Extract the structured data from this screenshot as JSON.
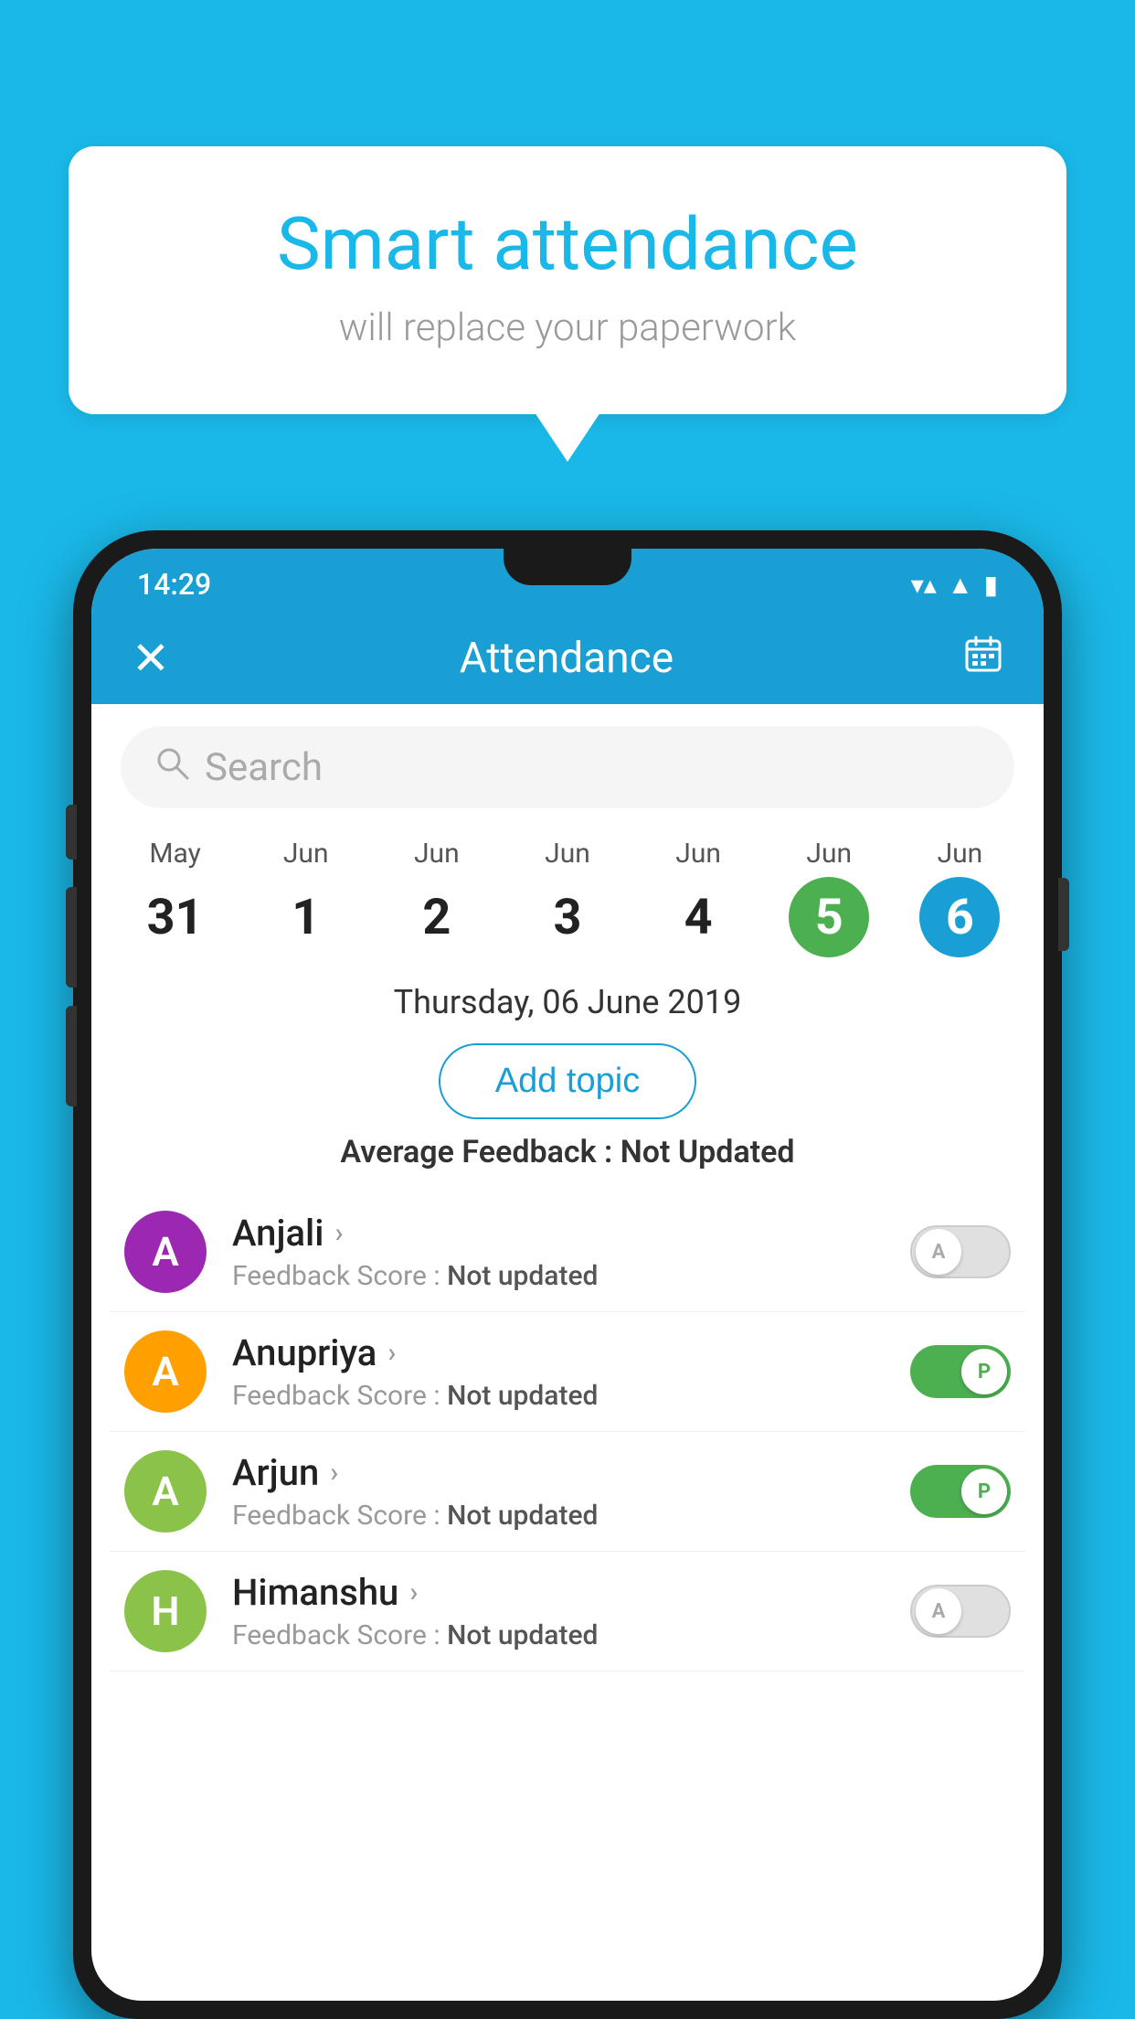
{
  "background_color": "#1ab8e8",
  "speech_bubble": {
    "title": "Smart attendance",
    "subtitle": "will replace your paperwork"
  },
  "status_bar": {
    "time": "14:29",
    "wifi": "▼",
    "signal": "▲",
    "battery": "▮"
  },
  "app_header": {
    "close_label": "✕",
    "title": "Attendance",
    "calendar_icon": "📅"
  },
  "search": {
    "placeholder": "Search"
  },
  "date_strip": {
    "dates": [
      {
        "month": "May",
        "day": "31",
        "state": "normal"
      },
      {
        "month": "Jun",
        "day": "1",
        "state": "normal"
      },
      {
        "month": "Jun",
        "day": "2",
        "state": "normal"
      },
      {
        "month": "Jun",
        "day": "3",
        "state": "normal"
      },
      {
        "month": "Jun",
        "day": "4",
        "state": "normal"
      },
      {
        "month": "Jun",
        "day": "5",
        "state": "today"
      },
      {
        "month": "Jun",
        "day": "6",
        "state": "selected"
      }
    ]
  },
  "selected_date_label": "Thursday, 06 June 2019",
  "add_topic_label": "Add topic",
  "avg_feedback_label": "Average Feedback :",
  "avg_feedback_value": "Not Updated",
  "students": [
    {
      "name": "Anjali",
      "avatar_letter": "A",
      "avatar_color": "#9c27b0",
      "feedback_label": "Feedback Score :",
      "feedback_value": "Not updated",
      "toggle": "off",
      "toggle_letter": "A"
    },
    {
      "name": "Anupriya",
      "avatar_letter": "A",
      "avatar_color": "#ffa000",
      "feedback_label": "Feedback Score :",
      "feedback_value": "Not updated",
      "toggle": "on",
      "toggle_letter": "P"
    },
    {
      "name": "Arjun",
      "avatar_letter": "A",
      "avatar_color": "#8bc34a",
      "feedback_label": "Feedback Score :",
      "feedback_value": "Not updated",
      "toggle": "on",
      "toggle_letter": "P"
    },
    {
      "name": "Himanshu",
      "avatar_letter": "H",
      "avatar_color": "#8bc34a",
      "feedback_label": "Feedback Score :",
      "feedback_value": "Not updated",
      "toggle": "off",
      "toggle_letter": "A"
    }
  ]
}
